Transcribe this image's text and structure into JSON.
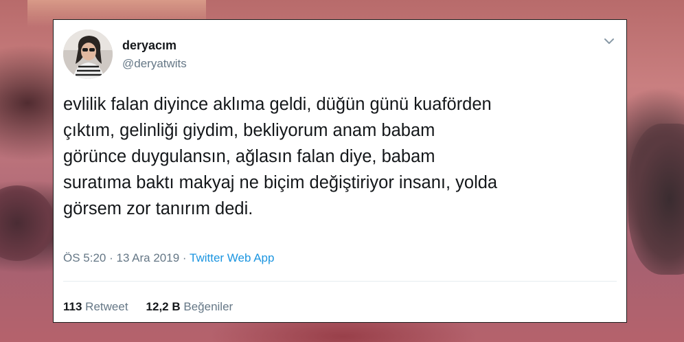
{
  "tweet": {
    "display_name": "deryacım",
    "handle": "@deryatwits",
    "text": "evlilik falan diyince aklıma geldi, düğün günü kuaförden\nçıktım, gelinliği giydim, bekliyorum anam babam\ngörünce duygulansın, ağlasın falan diye, babam\nsuratıma baktı makyaj ne biçim değiştiriyor insanı, yolda\ngörsem zor tanırım dedi.",
    "time": "ÖS 5:20",
    "separator1": " · ",
    "date": "13 Ara 2019",
    "separator2": " · ",
    "source": "Twitter Web App",
    "retweet_count": "113",
    "retweet_label": "Retweet",
    "like_count": "12,2 B",
    "like_label": "Beğeniler"
  },
  "icons": {
    "menu": "chevron-down-icon",
    "avatar": "avatar"
  },
  "colors": {
    "name": "#14171a",
    "secondary": "#657786",
    "link": "#1b95e0",
    "divider": "#e6ecf0"
  }
}
